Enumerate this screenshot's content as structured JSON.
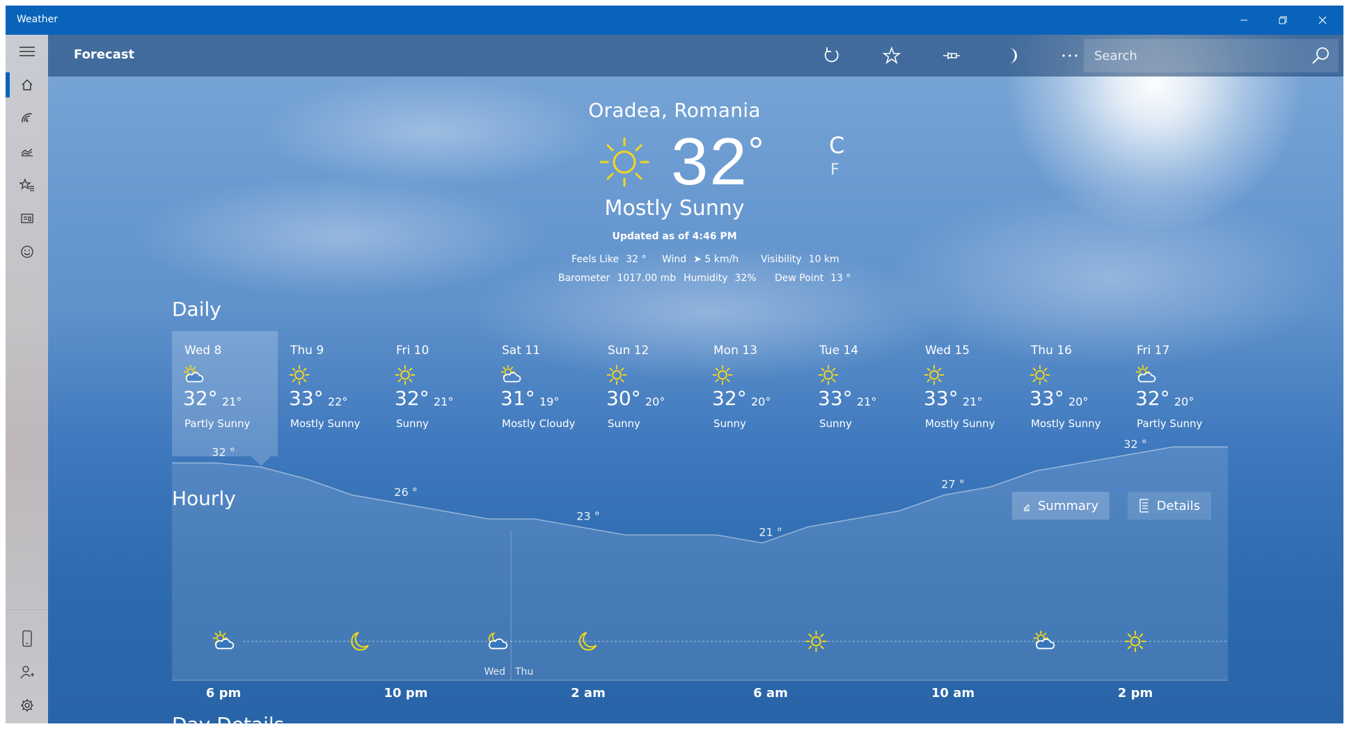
{
  "app": {
    "title": "Weather"
  },
  "header": {
    "title": "Forecast",
    "search_placeholder": "Search"
  },
  "current": {
    "location": "Oradea, Romania",
    "temp": "32",
    "unit_c": "C",
    "unit_f": "F",
    "condition": "Mostly Sunny",
    "updated": "Updated as of 4:46 PM",
    "metrics_row1": [
      {
        "label": "Feels Like",
        "value": "32 °"
      },
      {
        "label": "Wind",
        "value": "➤ 5 km/h"
      },
      {
        "label": "Visibility",
        "value": "10 km"
      }
    ],
    "metrics_row2": [
      {
        "label": "Barometer",
        "value": "1017.00 mb"
      },
      {
        "label": "Humidity",
        "value": "32%"
      },
      {
        "label": "Dew Point",
        "value": "13 °"
      }
    ]
  },
  "daily": {
    "title": "Daily",
    "selected_index": 0,
    "days": [
      {
        "name": "Wed 8",
        "icon": "partly-sunny",
        "hi": "32°",
        "lo": "21°",
        "cond": "Partly Sunny"
      },
      {
        "name": "Thu 9",
        "icon": "sunny",
        "hi": "33°",
        "lo": "22°",
        "cond": "Mostly Sunny"
      },
      {
        "name": "Fri 10",
        "icon": "sunny",
        "hi": "32°",
        "lo": "21°",
        "cond": "Sunny"
      },
      {
        "name": "Sat 11",
        "icon": "partly-sunny",
        "hi": "31°",
        "lo": "19°",
        "cond": "Mostly Cloudy"
      },
      {
        "name": "Sun 12",
        "icon": "sunny",
        "hi": "30°",
        "lo": "20°",
        "cond": "Sunny"
      },
      {
        "name": "Mon 13",
        "icon": "sunny",
        "hi": "32°",
        "lo": "20°",
        "cond": "Sunny"
      },
      {
        "name": "Tue 14",
        "icon": "sunny",
        "hi": "33°",
        "lo": "21°",
        "cond": "Sunny"
      },
      {
        "name": "Wed 15",
        "icon": "sunny",
        "hi": "33°",
        "lo": "21°",
        "cond": "Mostly Sunny"
      },
      {
        "name": "Thu 16",
        "icon": "sunny",
        "hi": "33°",
        "lo": "20°",
        "cond": "Mostly Sunny"
      },
      {
        "name": "Fri 17",
        "icon": "partly-sunny",
        "hi": "32°",
        "lo": "20°",
        "cond": "Partly Sunny"
      }
    ]
  },
  "hourly": {
    "title": "Hourly",
    "summary_label": "Summary",
    "details_label": "Details",
    "temp_labels": [
      {
        "text": "32 °",
        "hour": 0.0
      },
      {
        "text": "26 °",
        "hour": 4.0
      },
      {
        "text": "23 °",
        "hour": 8.0
      },
      {
        "text": "21 °",
        "hour": 12.0
      },
      {
        "text": "27 °",
        "hour": 16.0
      },
      {
        "text": "32 °",
        "hour": 20.0
      }
    ],
    "curve": [
      {
        "hour": -1.0,
        "temp": 32
      },
      {
        "hour": 0,
        "temp": 32
      },
      {
        "hour": 1,
        "temp": 31.5
      },
      {
        "hour": 2,
        "temp": 30
      },
      {
        "hour": 3,
        "temp": 28
      },
      {
        "hour": 4,
        "temp": 27
      },
      {
        "hour": 5,
        "temp": 26
      },
      {
        "hour": 6,
        "temp": 25
      },
      {
        "hour": 7,
        "temp": 25
      },
      {
        "hour": 8,
        "temp": 24
      },
      {
        "hour": 9,
        "temp": 23
      },
      {
        "hour": 10,
        "temp": 23
      },
      {
        "hour": 11,
        "temp": 23
      },
      {
        "hour": 12,
        "temp": 22
      },
      {
        "hour": 13,
        "temp": 24
      },
      {
        "hour": 14,
        "temp": 25
      },
      {
        "hour": 15,
        "temp": 26
      },
      {
        "hour": 16,
        "temp": 28
      },
      {
        "hour": 17,
        "temp": 29
      },
      {
        "hour": 18,
        "temp": 31
      },
      {
        "hour": 19,
        "temp": 32
      },
      {
        "hour": 20,
        "temp": 33
      },
      {
        "hour": 21,
        "temp": 34
      }
    ],
    "icons": [
      {
        "icon": "partly-sunny",
        "hour": 0.0
      },
      {
        "icon": "moon",
        "hour": 3.0
      },
      {
        "icon": "partly-cloudy-night",
        "hour": 6.0
      },
      {
        "icon": "moon",
        "hour": 8.0
      },
      {
        "icon": "sunny",
        "hour": 13.0
      },
      {
        "icon": "partly-sunny",
        "hour": 18.0
      },
      {
        "icon": "sunny",
        "hour": 20.0
      }
    ],
    "hour_labels": [
      {
        "text": "6 pm",
        "hour": 0
      },
      {
        "text": "10 pm",
        "hour": 4
      },
      {
        "text": "2 am",
        "hour": 8
      },
      {
        "text": "6 am",
        "hour": 12
      },
      {
        "text": "10 am",
        "hour": 16
      },
      {
        "text": "2 pm",
        "hour": 20
      }
    ],
    "day_split": {
      "left": "Wed",
      "right": "Thu",
      "hour": 6.0
    }
  },
  "day_details": {
    "title": "Day Details"
  },
  "sidebar": {
    "items": [
      {
        "name": "home",
        "active": true
      },
      {
        "name": "maps"
      },
      {
        "name": "historical-weather"
      },
      {
        "name": "places"
      },
      {
        "name": "news"
      },
      {
        "name": "feedback"
      }
    ],
    "bottom": [
      {
        "name": "phone"
      },
      {
        "name": "account"
      },
      {
        "name": "settings"
      }
    ]
  },
  "colors": {
    "accent": "#0a63ba",
    "sun": "#f5d71a"
  }
}
